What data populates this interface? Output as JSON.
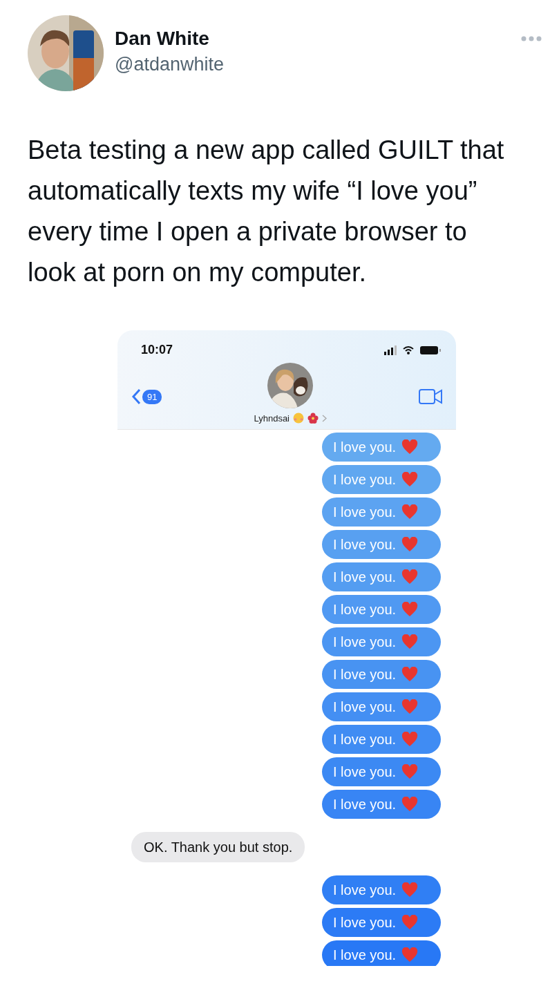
{
  "tweet": {
    "name": "Dan White",
    "handle": "@atdanwhite",
    "text": "Beta testing a new app called GUILT that automatically texts my wife “I love you” every time I open a private browser to look at porn on my computer."
  },
  "phone": {
    "time": "10:07",
    "back_count": "91",
    "contact_name": "Lyhndsai",
    "messages": [
      {
        "kind": "sent",
        "text": "I love you."
      },
      {
        "kind": "sent",
        "text": "I love you."
      },
      {
        "kind": "sent",
        "text": "I love you."
      },
      {
        "kind": "sent",
        "text": "I love you."
      },
      {
        "kind": "sent",
        "text": "I love you."
      },
      {
        "kind": "sent",
        "text": "I love you."
      },
      {
        "kind": "sent",
        "text": "I love you."
      },
      {
        "kind": "sent",
        "text": "I love you."
      },
      {
        "kind": "sent",
        "text": "I love you."
      },
      {
        "kind": "sent",
        "text": "I love you."
      },
      {
        "kind": "sent",
        "text": "I love you."
      },
      {
        "kind": "sent",
        "text": "I love you."
      },
      {
        "kind": "received",
        "text": "OK. Thank you but stop."
      },
      {
        "kind": "sent",
        "text": "I love you."
      },
      {
        "kind": "sent",
        "text": "I love you."
      },
      {
        "kind": "sent",
        "text": "I love you."
      }
    ]
  }
}
